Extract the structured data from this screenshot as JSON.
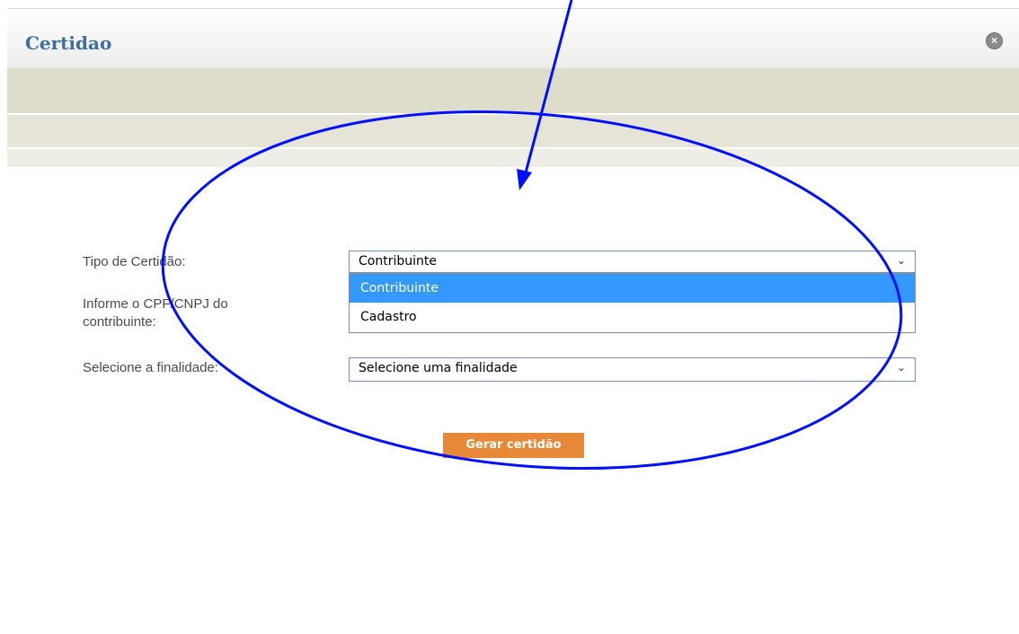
{
  "dialog": {
    "title": "Certidao",
    "close_icon": "close-circle-icon"
  },
  "form": {
    "tipo_label": "Tipo de Certidão:",
    "tipo_value": "Contribuinte",
    "tipo_options": [
      "Contribuinte",
      "Cadastro"
    ],
    "cpf_label_line1": "Informe o CPF/CNPJ do",
    "cpf_label_line2": "contribuinte:",
    "finalidade_label": "Selecione a finalidade:",
    "finalidade_value": "Selecione uma finalidade",
    "submit_label": "Gerar certidão"
  },
  "colors": {
    "title": "#3e6fa3",
    "button": "#e8893a",
    "selected_option": "#3399ff",
    "annotation": "#0010ff"
  }
}
